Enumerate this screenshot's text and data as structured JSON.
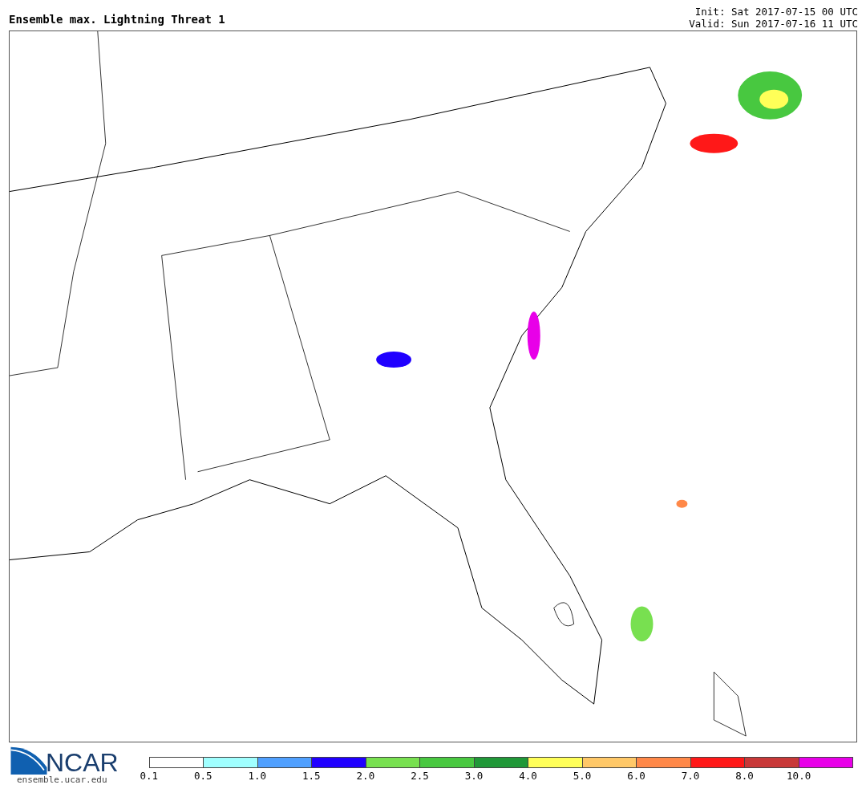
{
  "title": "Ensemble max. Lightning Threat 1",
  "init": "Init: Sat 2017-07-15 00 UTC",
  "valid": "Valid: Sun 2017-07-16 11 UTC",
  "logo": {
    "text": "NCAR",
    "url": "ensemble.ucar.edu"
  },
  "legend": [
    {
      "label": "0.1",
      "color": "#ffffff"
    },
    {
      "label": "0.5",
      "color": "#a0ffff"
    },
    {
      "label": "1.0",
      "color": "#50a0ff"
    },
    {
      "label": "1.5",
      "color": "#2000ff"
    },
    {
      "label": "2.0",
      "color": "#78e050"
    },
    {
      "label": "2.5",
      "color": "#48c840"
    },
    {
      "label": "3.0",
      "color": "#209838"
    },
    {
      "label": "4.0",
      "color": "#ffff58"
    },
    {
      "label": "5.0",
      "color": "#ffc868"
    },
    {
      "label": "6.0",
      "color": "#ff8848"
    },
    {
      "label": "7.0",
      "color": "#ff1818"
    },
    {
      "label": "8.0",
      "color": "#c83838"
    },
    {
      "label": "10.0",
      "color": "#e800e8"
    }
  ]
}
